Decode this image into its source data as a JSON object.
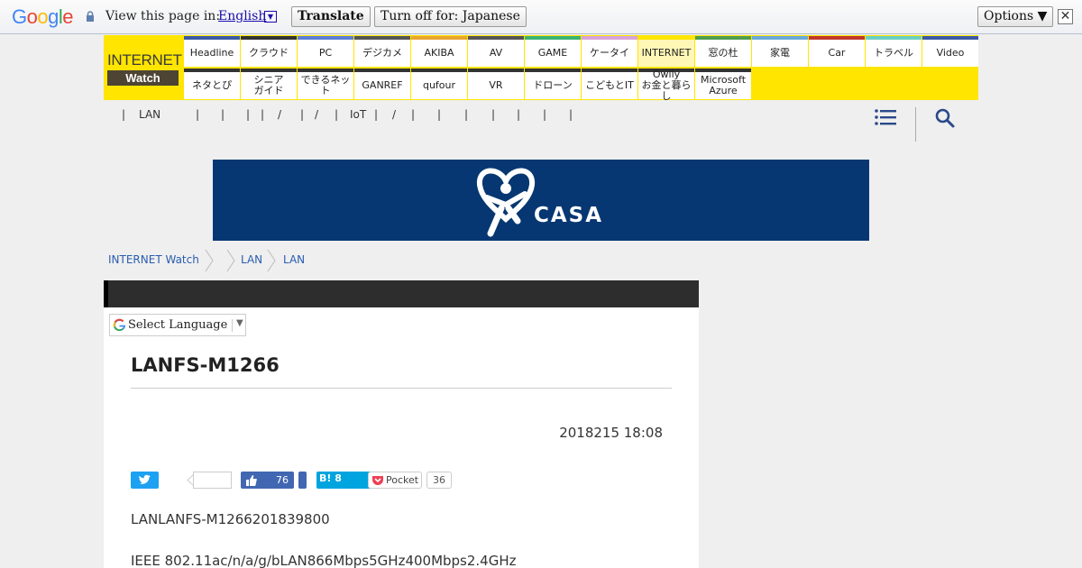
{
  "translate_bar": {
    "logo": "Google",
    "prompt": "View this page in:",
    "language": "English",
    "translate_label": "Translate",
    "turn_off_label": "Turn off for: Japanese",
    "options_label": "Options ▼",
    "close_label": "✕"
  },
  "site": {
    "logo_top": "INTERNET",
    "logo_bottom": "Watch",
    "nav_row1": [
      {
        "label": "Headline",
        "color": "#3b5aa6"
      },
      {
        "label": "クラウド",
        "color": "#333333"
      },
      {
        "label": "PC",
        "color": "#5b7fd6"
      },
      {
        "label": "デジカメ",
        "color": "#555555"
      },
      {
        "label": "AKIBA",
        "color": "#e8a530"
      },
      {
        "label": "AV",
        "color": "#555555"
      },
      {
        "label": "GAME",
        "color": "#3cb371"
      },
      {
        "label": "ケータイ",
        "color": "#d8a4d8"
      },
      {
        "label": "INTERNET",
        "color": "#ffe500"
      },
      {
        "label": "窓の杜",
        "color": "#4f9d4f"
      },
      {
        "label": "家電",
        "color": "#6aa9d8"
      },
      {
        "label": "Car",
        "color": "#c0392b"
      },
      {
        "label": "トラベル",
        "color": "#6ccfc2"
      },
      {
        "label": "Video",
        "color": "#3b5aa6"
      }
    ],
    "nav_row2": [
      {
        "label": "ネタとぴ",
        "color": "#333333"
      },
      {
        "label": "シニア\nガイド",
        "color": "#333333"
      },
      {
        "label": "できるネット",
        "color": "#333333"
      },
      {
        "label": "GANREF",
        "color": "#333333"
      },
      {
        "label": "qufour",
        "color": "#333333"
      },
      {
        "label": "VR",
        "color": "#333333"
      },
      {
        "label": "ドローン",
        "color": "#333333"
      },
      {
        "label": "こどもとIT",
        "color": "#333333"
      },
      {
        "label": "Owlly\nお金と暮らし",
        "color": "#333333"
      },
      {
        "label": "Microsoft\nAzure",
        "color": "#333333"
      }
    ],
    "subnav": [
      "|",
      "LAN",
      "|",
      "|",
      "|",
      "|",
      "/",
      "|",
      "/",
      "|",
      "IoT",
      "|",
      "/",
      "|",
      "|",
      "|",
      "|",
      "|",
      "|",
      "|"
    ]
  },
  "banner": {
    "brand": "CASA",
    "color": "#063772"
  },
  "breadcrumb": [
    "INTERNET Watch",
    "LAN",
    "LAN"
  ],
  "article": {
    "language_select": "Select Language",
    "title": "LANFS-M1266",
    "date": "2018215 18:08",
    "share": {
      "facebook_count": "76",
      "hatena_label": "B! 8",
      "pocket_label": "Pocket",
      "pocket_count": "36"
    },
    "paragraphs": [
      "LANLANFS-M1266201839800",
      "IEEE 802.11ac/n/a/g/bLAN866Mbps5GHz400Mbps2.4GHz"
    ]
  }
}
